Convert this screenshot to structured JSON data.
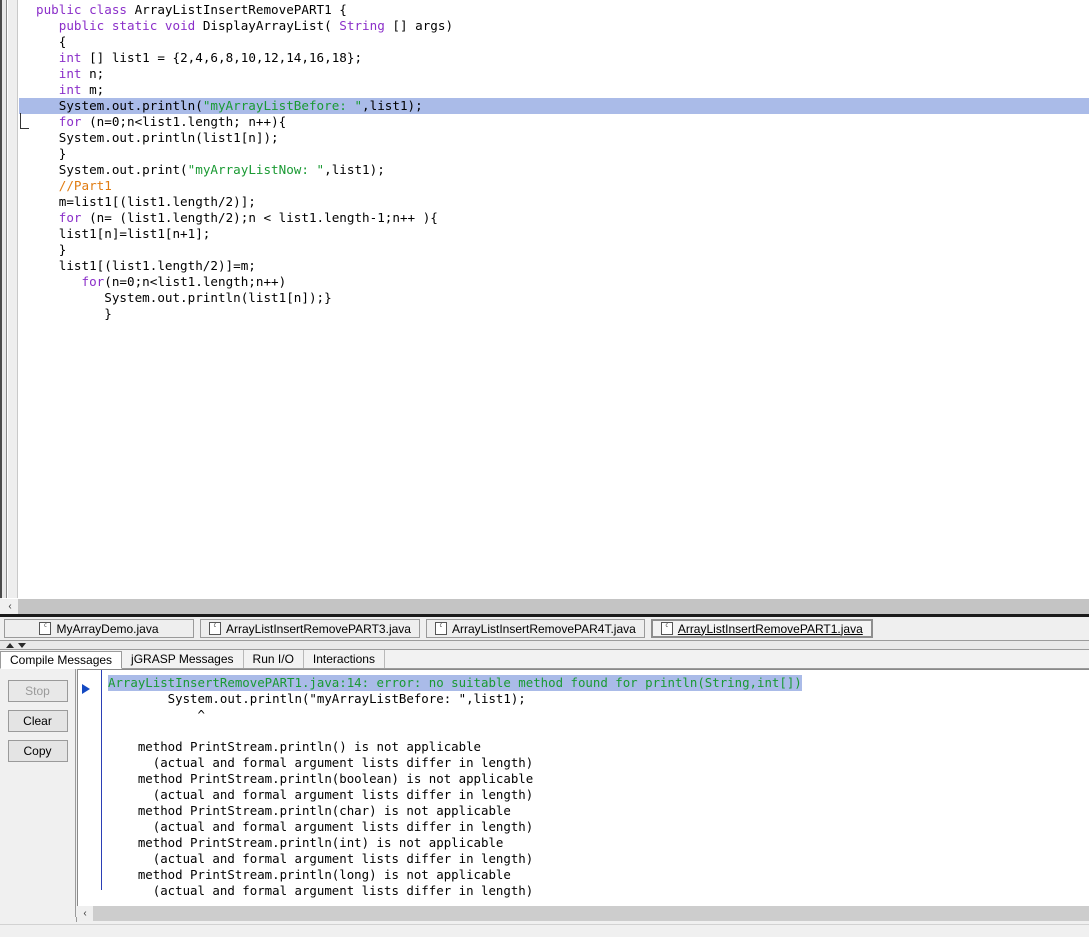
{
  "editor": {
    "code_lines": [
      [
        {
          "t": "public ",
          "c": "kw"
        },
        {
          "t": "class ",
          "c": "kw"
        },
        {
          "t": "ArrayListInsertRemovePART1 {",
          "c": "pl"
        }
      ],
      [
        {
          "t": "   ",
          "c": "pl"
        },
        {
          "t": "public static void ",
          "c": "kw"
        },
        {
          "t": "DisplayArrayList( ",
          "c": "pl"
        },
        {
          "t": "String ",
          "c": "kw"
        },
        {
          "t": "[] args)",
          "c": "pl"
        }
      ],
      [
        {
          "t": "   {",
          "c": "pl"
        }
      ],
      [
        {
          "t": "   ",
          "c": "pl"
        },
        {
          "t": "int ",
          "c": "kw"
        },
        {
          "t": "[] list1 = {2,4,6,8,10,12,14,16,18};",
          "c": "pl"
        }
      ],
      [
        {
          "t": "   ",
          "c": "pl"
        },
        {
          "t": "int ",
          "c": "kw"
        },
        {
          "t": "n;",
          "c": "pl"
        }
      ],
      [
        {
          "t": "   ",
          "c": "pl"
        },
        {
          "t": "int ",
          "c": "kw"
        },
        {
          "t": "m;",
          "c": "pl"
        }
      ],
      [
        {
          "t": "   System.out.println(",
          "c": "pl"
        },
        {
          "t": "\"myArrayListBefore: \"",
          "c": "str"
        },
        {
          "t": ",list1);",
          "c": "pl"
        }
      ],
      [
        {
          "t": "   ",
          "c": "pl"
        },
        {
          "t": "for ",
          "c": "kw"
        },
        {
          "t": "(n=0;n<list1.length; n++){",
          "c": "pl"
        }
      ],
      [
        {
          "t": "   System.out.println(list1[n]);",
          "c": "pl"
        }
      ],
      [
        {
          "t": "   }",
          "c": "pl"
        }
      ],
      [
        {
          "t": "   System.out.print(",
          "c": "pl"
        },
        {
          "t": "\"myArrayListNow: \"",
          "c": "str"
        },
        {
          "t": ",list1);",
          "c": "pl"
        }
      ],
      [
        {
          "t": "   //Part1",
          "c": "cmt"
        }
      ],
      [
        {
          "t": "   m=list1[(list1.length/2)];",
          "c": "pl"
        }
      ],
      [
        {
          "t": "   ",
          "c": "pl"
        },
        {
          "t": "for ",
          "c": "kw"
        },
        {
          "t": "(n= (list1.length/2);n < list1.length-1;n++ ){",
          "c": "pl"
        }
      ],
      [
        {
          "t": "   list1[n]=list1[n+1];",
          "c": "pl"
        }
      ],
      [
        {
          "t": "   }",
          "c": "pl"
        }
      ],
      [
        {
          "t": "   list1[(list1.length/2)]=m;",
          "c": "pl"
        }
      ],
      [
        {
          "t": "      ",
          "c": "pl"
        },
        {
          "t": "for",
          "c": "kw"
        },
        {
          "t": "(n=0;n<list1.length;n++)",
          "c": "pl"
        }
      ],
      [
        {
          "t": "         System.out.println(list1[n]);}",
          "c": "pl"
        }
      ],
      [
        {
          "t": "         }",
          "c": "pl"
        }
      ]
    ],
    "highlighted_line_index": 6,
    "scroll_left_label": "‹"
  },
  "file_tabs": [
    {
      "label": "MyArrayDemo.java",
      "active": false,
      "icon": "java-file-icon"
    },
    {
      "label": "ArrayListInsertRemovePART3.java",
      "active": false,
      "icon": "java-file-icon"
    },
    {
      "label": "ArrayListInsertRemovePAR4T.java",
      "active": false,
      "icon": "java-file-icon"
    },
    {
      "label": "ArrayListInsertRemovePART1.java",
      "active": true,
      "icon": "java-file-icon"
    }
  ],
  "message_tabs": [
    {
      "label": "Compile Messages",
      "active": true
    },
    {
      "label": "jGRASP Messages",
      "active": false
    },
    {
      "label": "Run I/O",
      "active": false
    },
    {
      "label": "Interactions",
      "active": false
    }
  ],
  "buttons": [
    {
      "label": "Stop",
      "enabled": false
    },
    {
      "label": "Clear",
      "enabled": true
    },
    {
      "label": "Copy",
      "enabled": true
    }
  ],
  "messages": {
    "error_headline": "ArrayListInsertRemovePART1.java:14: error: no suitable method found for println(String,int[])",
    "lines": [
      "        System.out.println(\"myArrayListBefore: \",list1);",
      "            ^",
      "",
      "    method PrintStream.println() is not applicable",
      "      (actual and formal argument lists differ in length)",
      "    method PrintStream.println(boolean) is not applicable",
      "      (actual and formal argument lists differ in length)",
      "    method PrintStream.println(char) is not applicable",
      "      (actual and formal argument lists differ in length)",
      "    method PrintStream.println(int) is not applicable",
      "      (actual and formal argument lists differ in length)",
      "    method PrintStream.println(long) is not applicable",
      "      (actual and formal argument lists differ in length)"
    ],
    "scroll_left_label": "‹"
  },
  "colors": {
    "keyword": "#8b2fc9",
    "string": "#1a9a33",
    "comment": "#e07b10",
    "selection": "#aabbe8",
    "error_text": "#1a9a33",
    "marker": "#1449c2"
  }
}
